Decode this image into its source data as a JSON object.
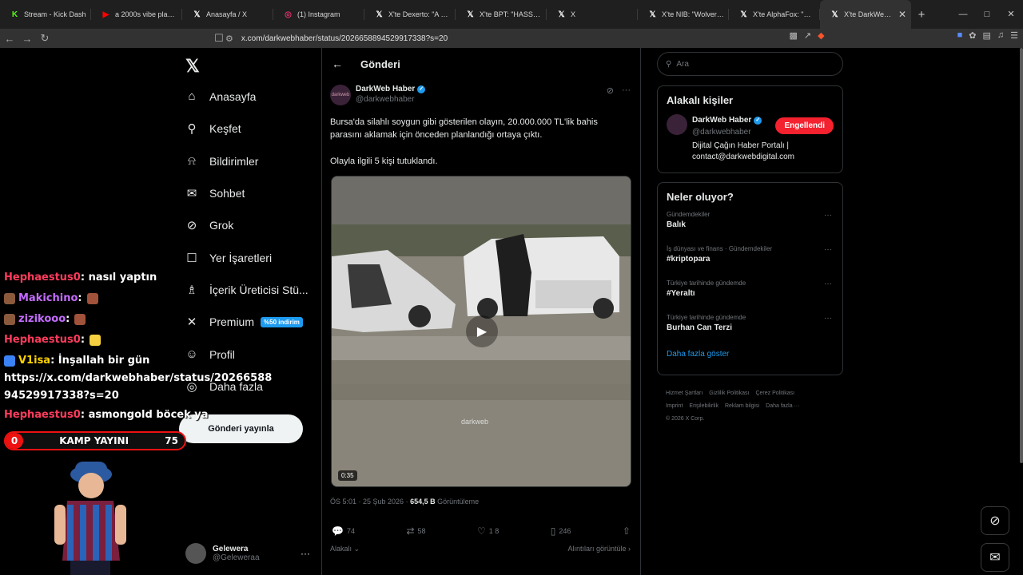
{
  "browser": {
    "tabs": [
      {
        "label": "Stream - Kick Dash",
        "icon": "kick-icon",
        "color": "#53fc18"
      },
      {
        "label": "a 2000s vibe playlist",
        "icon": "youtube-icon",
        "color": "#ff0000"
      },
      {
        "label": "Anasayfa / X",
        "icon": "x-icon",
        "color": "#ffffff"
      },
      {
        "label": "(1) Instagram",
        "icon": "instagram-icon",
        "color": "#e1306c"
      },
      {
        "label": "X'te Dexerto: \"A Univer",
        "icon": "x-icon",
        "color": "#ffffff"
      },
      {
        "label": "X'te BPT: \"HASSAS | Es",
        "icon": "x-icon",
        "color": "#ffffff"
      },
      {
        "label": "X",
        "icon": "x-icon",
        "color": "#ffffff"
      },
      {
        "label": "X'te NIB: \"Wolverine la",
        "icon": "x-icon",
        "color": "#ffffff"
      },
      {
        "label": "X'te AlphaFox: \"Omar y",
        "icon": "x-icon",
        "color": "#ffffff"
      },
      {
        "label": "X'te DarkWeb Hab",
        "icon": "x-icon",
        "color": "#ffffff",
        "active": true
      }
    ],
    "url": "x.com/darkwebhaber/status/2026658894529917338?s=20"
  },
  "nav": {
    "items": [
      {
        "label": "Anasayfa",
        "icon": "home-icon"
      },
      {
        "label": "Keşfet",
        "icon": "search-icon"
      },
      {
        "label": "Bildirimler",
        "icon": "bell-icon"
      },
      {
        "label": "Sohbet",
        "icon": "mail-icon"
      },
      {
        "label": "Grok",
        "icon": "grok-icon"
      },
      {
        "label": "Yer İşaretleri",
        "icon": "bookmark-icon"
      },
      {
        "label": "İçerik Üreticisi Stü...",
        "icon": "creator-icon"
      },
      {
        "label": "Premium",
        "icon": "x-icon",
        "badge": "%50 indirim"
      },
      {
        "label": "Profil",
        "icon": "profile-icon"
      },
      {
        "label": "Daha fazla",
        "icon": "more-circle-icon"
      }
    ],
    "post_button": "Gönderi yayınla",
    "account": {
      "name": "Gelewera",
      "handle": "@Geleweraa"
    }
  },
  "post": {
    "header": "Gönderi",
    "author": {
      "name": "DarkWeb Haber",
      "handle": "@darkwebhaber",
      "avatar_text": "darkweb"
    },
    "text1": "Bursa'da silahlı soygun gibi gösterilen olayın, 20.000.000 TL'lik bahis parasını aklamak için önceden planlandığı ortaya çıktı.",
    "text2": "Olayla ilgili 5 kişi tutuklandı.",
    "video": {
      "duration": "0:35",
      "watermark": "darkweb"
    },
    "meta": {
      "time": "ÖS 5:01 · 25 Şub 2026 ·",
      "views": "654,5 B",
      "views_label": "Görüntüleme"
    },
    "actions": {
      "replies": "74",
      "reposts": "58",
      "likes": "1 8",
      "bookmarks": "246"
    },
    "reply_option": "Alakalı",
    "quotes_link": "Alıntıları görüntüle"
  },
  "sidebar": {
    "search_placeholder": "Ara",
    "related_title": "Alakalı kişiler",
    "related": {
      "name": "DarkWeb Haber",
      "handle": "@darkwebhaber",
      "bio": "Dijital Çağın Haber Portalı | contact@darkwebdigital.com",
      "button": "Engellendi"
    },
    "trends_title": "Neler oluyor?",
    "trends": [
      {
        "context": "Gündemdekiler",
        "title": "Balık"
      },
      {
        "context": "İş dünyası ve finans · Gündemdekiler",
        "title": "#kriptopara"
      },
      {
        "context": "Türkiye tarihinde gündemde",
        "title": "#Yeraltı"
      },
      {
        "context": "Türkiye tarihinde gündemde",
        "title": "Burhan Can Terzi"
      }
    ],
    "show_more": "Daha fazla göster",
    "footer": [
      "Hizmet Şartları",
      "Gizlilik Politikası",
      "Çerez Politikası",
      "Imprint",
      "Erişilebilirlik",
      "Reklam bilgisi",
      "Daha fazla ···",
      "© 2026 X Corp."
    ]
  },
  "stream_overlay": {
    "chat": [
      {
        "user": "Hephaestus0",
        "message": ": nasıl yaptın"
      },
      {
        "user": "Makichino",
        "message": ":"
      },
      {
        "user": "zizikooo",
        "message": ":"
      },
      {
        "user": "Hephaestus0",
        "message": ":"
      },
      {
        "user": "V1isa",
        "message": ": İnşallah bir gün"
      },
      {
        "user": "",
        "message": "https://x.com/darkwebhaber/status/20266588"
      },
      {
        "user": "",
        "message": "94529917338?s=20"
      },
      {
        "user": "Hephaestus0",
        "message": ": asmongold böcek ya"
      }
    ],
    "progress": {
      "left": "0",
      "title": "KAMP YAYINI",
      "right": "75"
    }
  }
}
